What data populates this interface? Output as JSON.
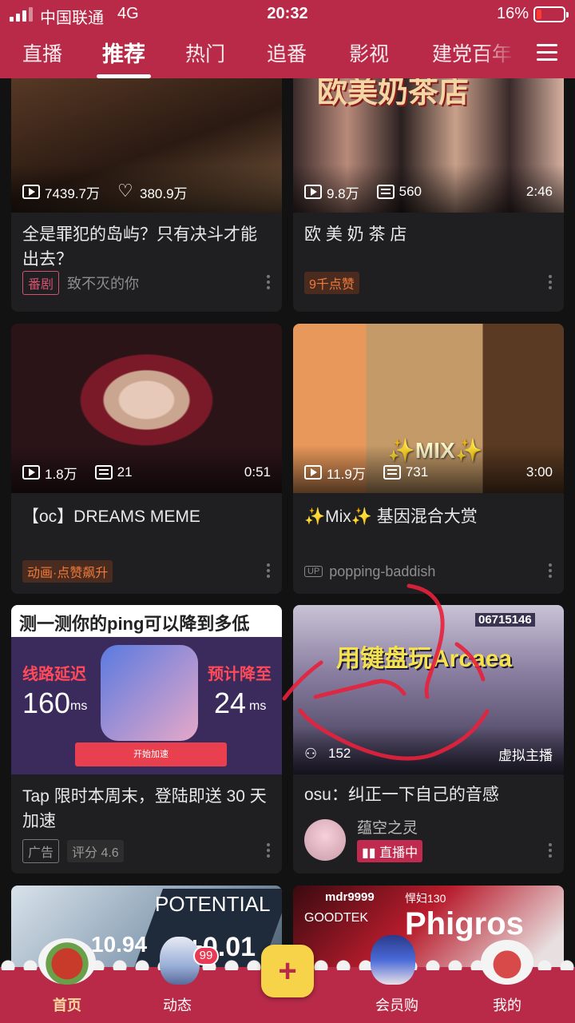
{
  "status_bar": {
    "carrier": "中国联通",
    "network": "4G",
    "time": "20:32",
    "battery_percent": "16%",
    "battery_level": 0.16
  },
  "tabs": [
    {
      "label": "直播",
      "active": false
    },
    {
      "label": "推荐",
      "active": true
    },
    {
      "label": "热门",
      "active": false
    },
    {
      "label": "追番",
      "active": false
    },
    {
      "label": "影视",
      "active": false
    },
    {
      "label": "建党百年",
      "active": false
    }
  ],
  "cards": [
    {
      "thumb_text": "",
      "stat1": "7439.7万",
      "stat1_icon": "play-icon",
      "stat2": "380.9万",
      "stat2_icon": "heart-icon",
      "duration": "",
      "title": "全是罪犯的岛屿？只有决斗才能出去？",
      "tag": "番剧",
      "author": "致不灭的你"
    },
    {
      "thumb_text": "欧美奶茶店",
      "stat1": "9.8万",
      "stat1_icon": "play-icon",
      "stat2": "560",
      "stat2_icon": "danmaku-icon",
      "duration": "2:46",
      "title": "欧 美 奶 茶 店",
      "tag": "9千点赞",
      "author": ""
    },
    {
      "thumb_text": "",
      "stat1": "1.8万",
      "stat1_icon": "play-icon",
      "stat2": "21",
      "stat2_icon": "danmaku-icon",
      "duration": "0:51",
      "title": "【oc】DREAMS MEME",
      "tag": "动画·点赞飙升",
      "author": ""
    },
    {
      "thumb_text": "✨MIX✨",
      "stat1": "11.9万",
      "stat1_icon": "play-icon",
      "stat2": "731",
      "stat2_icon": "danmaku-icon",
      "duration": "3:00",
      "title": "✨Mix✨ 基因混合大赏",
      "tag": "UP",
      "author": "popping-baddish"
    },
    {
      "thumb_headline": "测一测你的ping可以降到多低",
      "thumb_left_label": "线路延迟",
      "thumb_left_value": "160",
      "thumb_right_label": "预计降至",
      "thumb_right_value": "24",
      "thumb_unit": "ms",
      "thumb_button": "开始加速",
      "title": "Tap 限时本周末，登陆即送 30 天加速",
      "tag": "广告",
      "rating": "评分 4.6"
    },
    {
      "thumb_text": "用键盘玩Arcaea",
      "thumb_score": "06715146",
      "stat1": "152",
      "stat1_icon": "people-icon",
      "live_label": "虚拟主播",
      "title": "osu：纠正一下自己的音感",
      "author": "蕴空之灵",
      "live_badge": "直播中"
    },
    {
      "thumb_text": "POTENTIAL",
      "thumb_sub": "10.94",
      "thumb_sub2": "+0.01"
    },
    {
      "thumb_text": "Phigros",
      "thumb_user": "mdr9999",
      "thumb_tag": "GOODTEK",
      "thumb_rank": "悍妇130"
    }
  ],
  "bottom_nav": [
    {
      "label": "首页",
      "active": true
    },
    {
      "label": "动态",
      "active": false,
      "badge": "99"
    },
    {
      "label": "",
      "active": false
    },
    {
      "label": "会员购",
      "active": false
    },
    {
      "label": "我的",
      "active": false
    }
  ],
  "colors": {
    "brand": "#b82a48",
    "card": "#1f1f21",
    "accent_orange": "#f07a3a",
    "accent_pink": "#d2526f",
    "doodle": "#e8213c"
  }
}
